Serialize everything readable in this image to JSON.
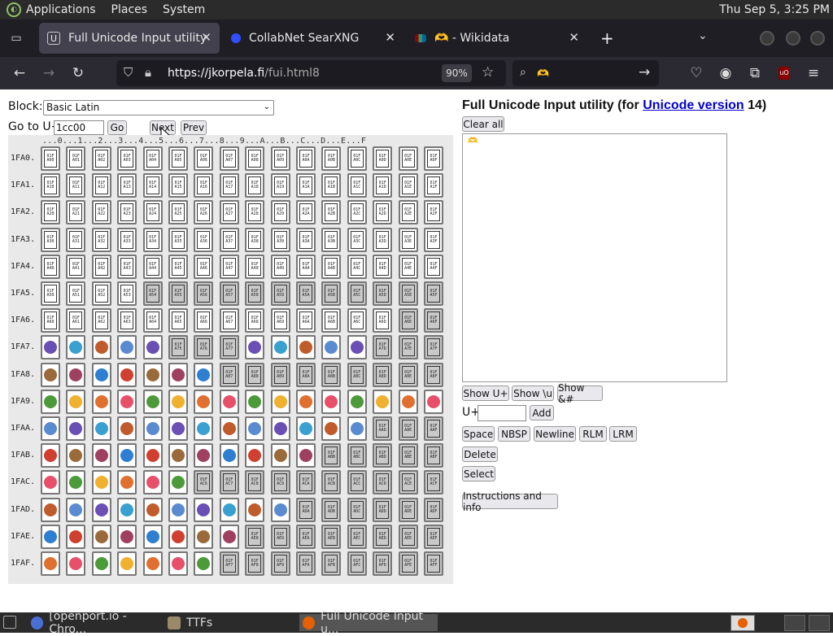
{
  "os": {
    "menus": [
      "Applications",
      "Places",
      "System"
    ],
    "clock": "Thu Sep  5,  3:25 PM",
    "taskbar": [
      {
        "label": "[openport.io - Chro...",
        "active": false
      },
      {
        "label": "TTFs",
        "active": false
      },
      {
        "label": "Full Unicode Input u...",
        "active": true
      }
    ]
  },
  "browser": {
    "tabs": [
      {
        "label": "Full Unicode Input utility",
        "active": true
      },
      {
        "label": "CollabNet SearXNG",
        "active": false
      },
      {
        "label": "🫶 - Wikidata",
        "active": false
      }
    ],
    "url_host": "https://jkorpela.fi",
    "url_path": "/fui.html8",
    "zoom": "90%",
    "search_value": "🫶"
  },
  "fui": {
    "block_label": "Block:",
    "block_value": "Basic Latin",
    "goto_label": "Go to U+",
    "goto_value": "1cc00",
    "go_btn": "Go",
    "next_btn": "Next",
    "prev_btn": "Prev",
    "col_header": "...0...1...2...3...4...5...6...7...8...9...A...B...C...D...E...F",
    "rows": [
      {
        "label": "1FA0.",
        "cells": [
          "",
          "",
          "",
          "",
          "",
          "",
          "",
          "",
          "",
          "",
          "",
          "",
          "",
          "",
          "",
          ""
        ]
      },
      {
        "label": "1FA1.",
        "cells": [
          "",
          "",
          "",
          "",
          "",
          "",
          "",
          "",
          "",
          "",
          "",
          "",
          "",
          "",
          "",
          ""
        ]
      },
      {
        "label": "1FA2.",
        "cells": [
          "",
          "",
          "",
          "",
          "",
          "",
          "",
          "",
          "",
          "",
          "",
          "",
          "",
          "",
          "",
          ""
        ]
      },
      {
        "label": "1FA3.",
        "cells": [
          "",
          "",
          "",
          "",
          "",
          "",
          "",
          "",
          "",
          "",
          "",
          "",
          "",
          "",
          "",
          ""
        ]
      },
      {
        "label": "1FA4.",
        "cells": [
          "",
          "",
          "",
          "",
          "",
          "",
          "",
          "",
          "",
          "",
          "",
          "",
          "",
          "",
          "",
          ""
        ]
      },
      {
        "label": "1FA5.",
        "cells": [
          "",
          "",
          "",
          "",
          "d",
          "d",
          "d",
          "d",
          "d",
          "d",
          "d",
          "d",
          "d",
          "d",
          "d",
          "d"
        ]
      },
      {
        "label": "1FA6.",
        "cells": [
          "",
          "",
          "",
          "",
          "",
          "",
          "",
          "",
          "",
          "",
          "",
          "",
          "",
          "",
          "d",
          "d"
        ]
      },
      {
        "label": "1FA7.",
        "cells": [
          "e",
          "e",
          "e",
          "e",
          "e",
          "d",
          "d",
          "d",
          "e",
          "e",
          "e",
          "e",
          "e",
          "d",
          "d",
          "d"
        ]
      },
      {
        "label": "1FA8.",
        "cells": [
          "e",
          "e",
          "e",
          "e",
          "e",
          "e",
          "e",
          "d",
          "d",
          "d",
          "d",
          "d",
          "d",
          "d",
          "d",
          "d"
        ]
      },
      {
        "label": "1FA9.",
        "cells": [
          "e",
          "e",
          "e",
          "e",
          "e",
          "e",
          "e",
          "e",
          "e",
          "e",
          "e",
          "e",
          "e",
          "e",
          "e",
          "e"
        ]
      },
      {
        "label": "1FAA.",
        "cells": [
          "e",
          "e",
          "e",
          "e",
          "e",
          "e",
          "e",
          "e",
          "e",
          "e",
          "e",
          "e",
          "e",
          "d",
          "d",
          "d"
        ]
      },
      {
        "label": "1FAB.",
        "cells": [
          "e",
          "e",
          "e",
          "e",
          "e",
          "e",
          "e",
          "e",
          "e",
          "e",
          "e",
          "d",
          "d",
          "d",
          "d",
          "d"
        ]
      },
      {
        "label": "1FAC.",
        "cells": [
          "e",
          "e",
          "e",
          "e",
          "e",
          "e",
          "d",
          "d",
          "d",
          "d",
          "d",
          "d",
          "d",
          "d",
          "d",
          "d"
        ]
      },
      {
        "label": "1FAD.",
        "cells": [
          "e",
          "e",
          "e",
          "e",
          "e",
          "e",
          "e",
          "e",
          "e",
          "e",
          "d",
          "d",
          "d",
          "d",
          "d",
          "d"
        ]
      },
      {
        "label": "1FAE.",
        "cells": [
          "e",
          "e",
          "e",
          "e",
          "e",
          "e",
          "e",
          "e",
          "d",
          "d",
          "d",
          "d",
          "d",
          "d",
          "d",
          "d"
        ]
      },
      {
        "label": "1FAF.",
        "cells": [
          "e",
          "e",
          "e",
          "e",
          "e",
          "e",
          "e",
          "d",
          "d",
          "d",
          "d",
          "d",
          "d",
          "d",
          "d",
          "d"
        ]
      }
    ],
    "title_pre": "Full Unicode Input utility (for ",
    "title_link": "Unicode version",
    "title_post": " 14)",
    "clear_all": "Clear all",
    "textarea_value": "🫶",
    "show_uplus": "Show U+",
    "show_u": "Show \\u",
    "show_amp": "Show &#",
    "uplus_label": "U+",
    "add_btn": "Add",
    "space_btn": "Space",
    "nbsp_btn": "NBSP",
    "newline_btn": "Newline",
    "rlm_btn": "RLM",
    "lrm_btn": "LRM",
    "delete_btn": "Delete",
    "select_btn": "Select",
    "instructions_btn": "Instructions and info"
  }
}
